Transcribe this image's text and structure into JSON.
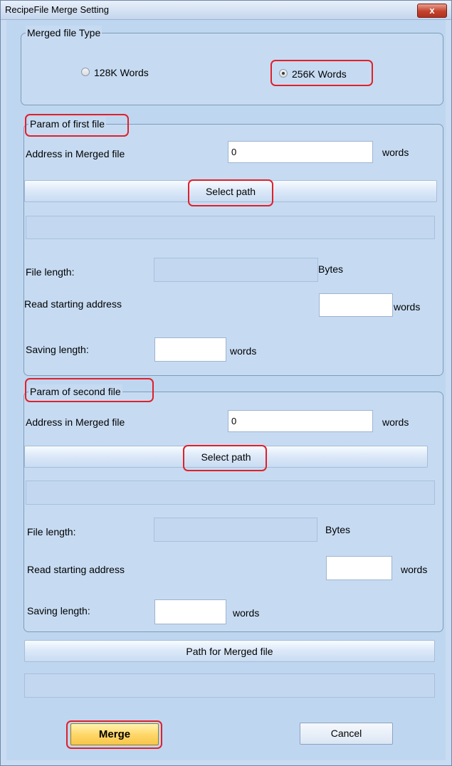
{
  "window": {
    "title": "RecipeFile Merge Setting",
    "close_label": "x"
  },
  "merged_type": {
    "legend": "Merged file Type",
    "option_128": "128K Words",
    "option_256": "256K Words",
    "selected": "256K Words"
  },
  "first_file": {
    "legend": "Param of first file",
    "address_label": "Address in Merged file",
    "address_value": "0",
    "address_unit": "words",
    "select_path_label": "Select path",
    "path_value": "",
    "file_length_label": "File length:",
    "file_length_value": "",
    "file_length_unit": "Bytes",
    "read_start_label": "Read starting address",
    "read_start_value": "",
    "read_start_unit": "words",
    "saving_length_label": "Saving length:",
    "saving_length_value": "",
    "saving_length_unit": "words"
  },
  "second_file": {
    "legend": "Param of second file",
    "address_label": "Address in Merged file",
    "address_value": "0",
    "address_unit": "words",
    "select_path_label": "Select path",
    "path_value": "",
    "file_length_label": "File length:",
    "file_length_value": "",
    "file_length_unit": "Bytes",
    "read_start_label": "Read starting address",
    "read_start_value": "",
    "read_start_unit": "words",
    "saving_length_label": "Saving length:",
    "saving_length_value": "",
    "saving_length_unit": "words"
  },
  "merged_path": {
    "button_label": "Path for Merged file",
    "path_value": ""
  },
  "actions": {
    "merge_label": "Merge",
    "cancel_label": "Cancel"
  },
  "colors": {
    "highlight": "#e0202a",
    "background": "#c6dbf2",
    "default_button": "#ffd86a"
  }
}
